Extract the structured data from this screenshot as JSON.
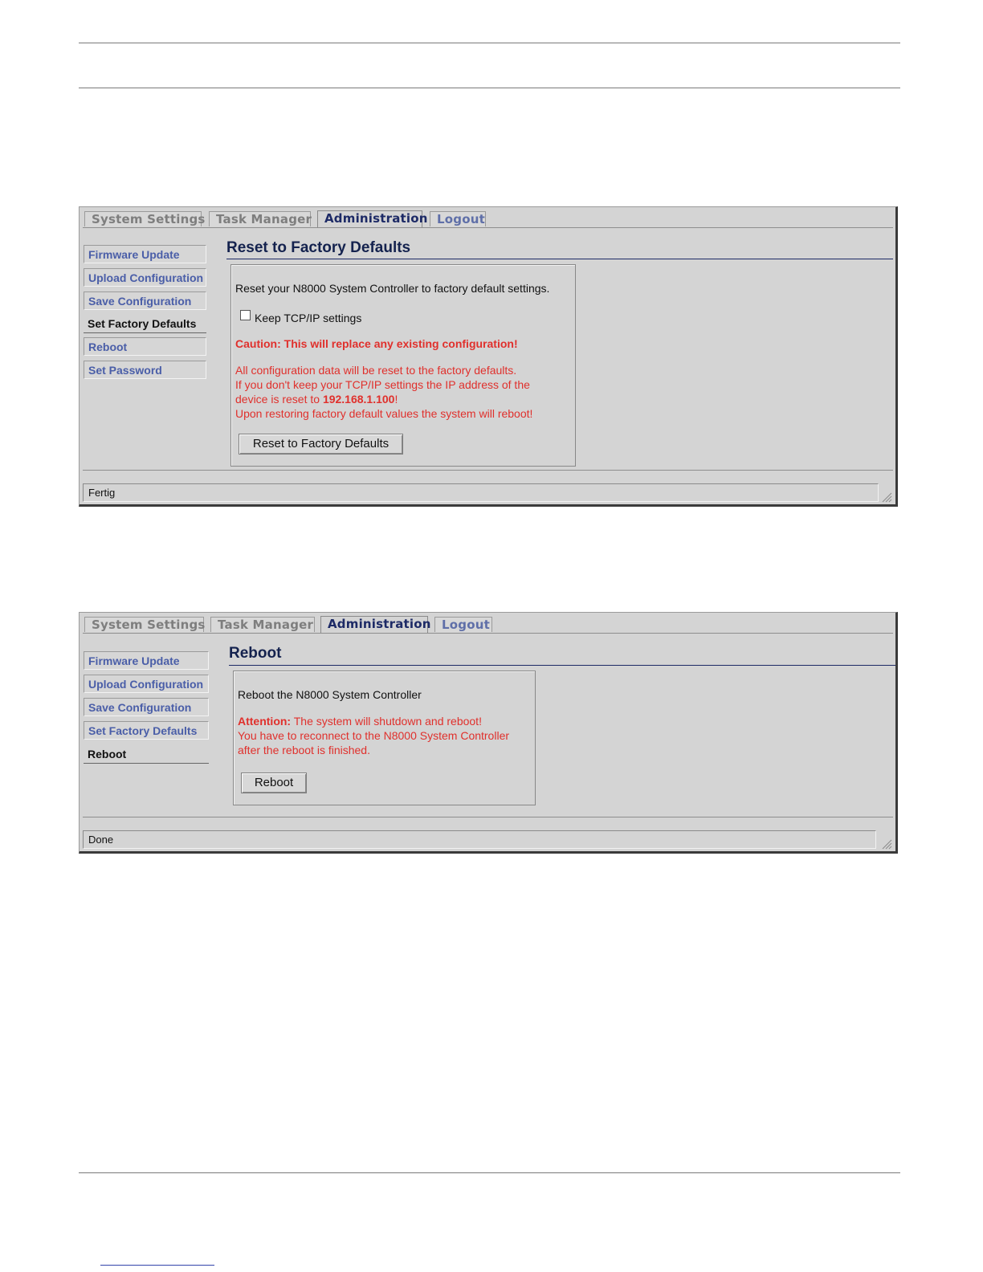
{
  "screen1": {
    "tabs": [
      "System Settings",
      "Task Manager",
      "Administration",
      "Logout"
    ],
    "menu": [
      "Firmware Update",
      "Upload Configuration",
      "Save Configuration",
      "Set Factory Defaults",
      "Reboot",
      "Set Password"
    ],
    "selected_menu": "Set Factory Defaults",
    "title": "Reset to Factory Defaults",
    "intro": "Reset your N8000 System Controller to factory default settings.",
    "checkbox_label": "Keep TCP/IP settings",
    "checkbox_checked": false,
    "caution": "Caution: This will replace any existing configuration!",
    "line1": "All configuration data will be reset to the factory defaults.",
    "line2": "If you don't keep your TCP/IP settings the IP address of the",
    "line3_prefix": "device is reset to ",
    "ip_address": "192.168.1.100",
    "line3_suffix": "!",
    "line4": "Upon restoring factory default values the system will reboot!",
    "button": "Reset to Factory Defaults",
    "status": "Fertig"
  },
  "screen2": {
    "tabs": [
      "System Settings",
      "Task Manager",
      "Administration",
      "Logout"
    ],
    "menu": [
      "Firmware Update",
      "Upload Configuration",
      "Save Configuration",
      "Set Factory Defaults",
      "Reboot"
    ],
    "selected_menu": "Reboot",
    "title": "Reboot",
    "intro": "Reboot the N8000 System Controller",
    "attention_label": "Attention:",
    "attention_text": " The system will shutdown and reboot!",
    "line2": "You have to reconnect to the N8000 System Controller",
    "line3": "after the reboot is finished.",
    "button": "Reboot",
    "status": "Done"
  },
  "colors": {
    "accent": "#1d2a66",
    "warning": "#e0302c",
    "window_bg": "#d4d4d4"
  }
}
